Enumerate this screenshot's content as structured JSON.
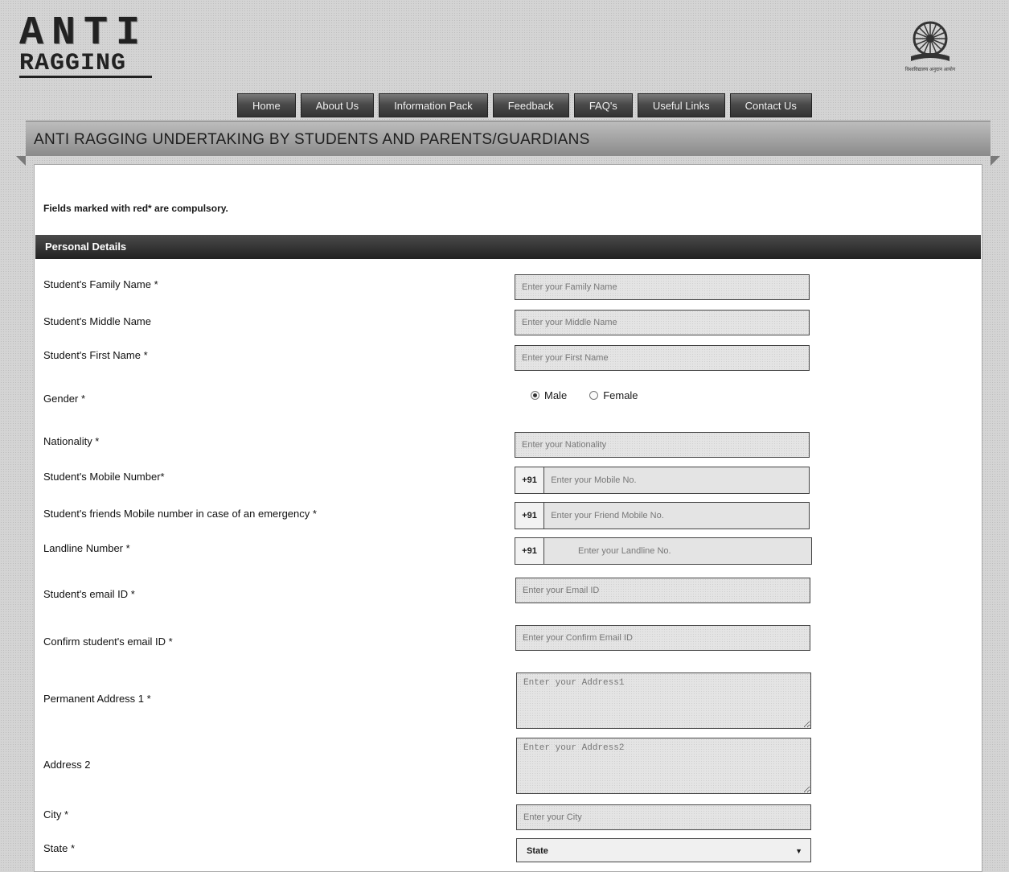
{
  "header": {
    "logo_line1": "ANTI",
    "logo_line2": "RAGGING",
    "emblem_caption": "विश्वविद्यालय अनुदान आयोग"
  },
  "nav": {
    "items": [
      "Home",
      "About Us",
      "Information Pack",
      "Feedback",
      "FAQ's",
      "Useful Links",
      "Contact Us"
    ]
  },
  "banner": {
    "title": "ANTI RAGGING UNDERTAKING BY STUDENTS AND PARENTS/GUARDIANS"
  },
  "form": {
    "note": "Fields marked with red* are compulsory.",
    "section_title": "Personal Details",
    "family_name": {
      "label": "Student's Family Name *",
      "placeholder": "Enter your Family Name"
    },
    "middle_name": {
      "label": "Student's Middle Name",
      "placeholder": "Enter your Middle Name"
    },
    "first_name": {
      "label": "Student's First Name *",
      "placeholder": "Enter your First Name"
    },
    "gender": {
      "label": "Gender *",
      "options": [
        "Male",
        "Female"
      ],
      "selected": "Male"
    },
    "nationality": {
      "label": "Nationality *",
      "placeholder": "Enter your Nationality"
    },
    "mobile": {
      "label": "Student's Mobile Number*",
      "prefix": "+91",
      "placeholder": "Enter your Mobile No."
    },
    "friend_mobile": {
      "label": "Student's friends Mobile number in case of an emergency *",
      "prefix": "+91",
      "placeholder": "Enter your Friend Mobile No."
    },
    "landline": {
      "label": "Landline Number *",
      "prefix": "+91",
      "placeholder": "Enter your Landline No."
    },
    "email": {
      "label": "Student's email ID *",
      "placeholder": "Enter your Email ID"
    },
    "confirm_email": {
      "label": "Confirm student's email ID *",
      "placeholder": "Enter your Confirm Email ID"
    },
    "address1": {
      "label": "Permanent Address 1 *",
      "placeholder": "Enter your Address1"
    },
    "address2": {
      "label": "Address 2",
      "placeholder": "Enter your Address2"
    },
    "city": {
      "label": "City *",
      "placeholder": "Enter your City"
    },
    "state": {
      "label": "State *",
      "selected": "State"
    }
  }
}
